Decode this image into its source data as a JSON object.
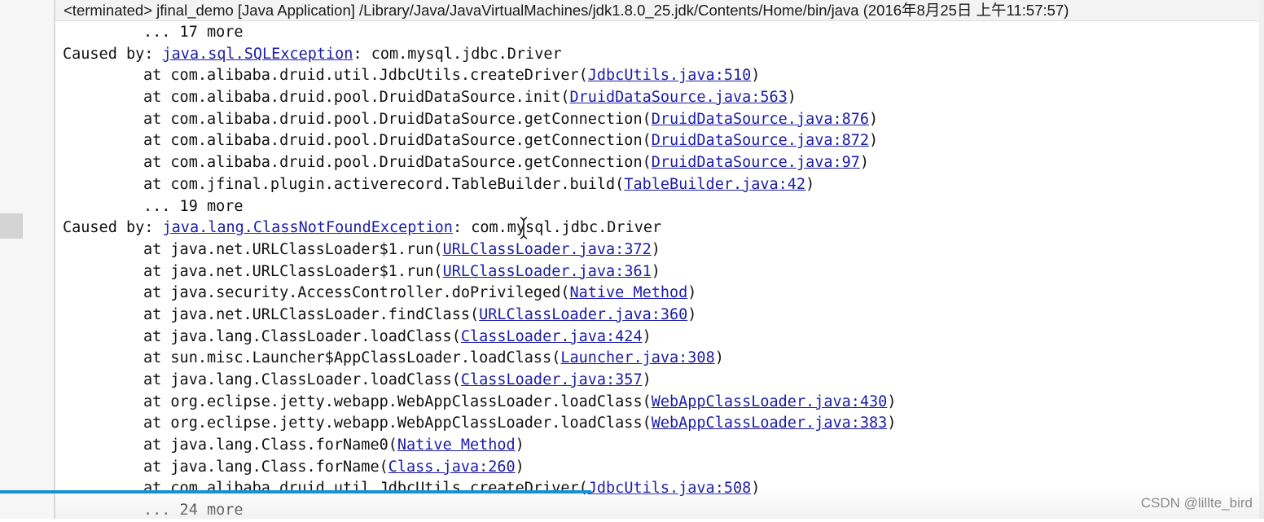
{
  "title_bar": "<terminated> jfinal_demo [Java Application] /Library/Java/JavaVirtualMachines/jdk1.8.0_25.jdk/Contents/Home/bin/java (2016年8月25日 上午11:57:57)",
  "console": {
    "lines": [
      {
        "indent": true,
        "prefix": "... 17 more",
        "link": "",
        "suffix": ""
      },
      {
        "indent": false,
        "prefix": "Caused by: ",
        "link": "java.sql.SQLException",
        "suffix": ": com.mysql.jdbc.Driver"
      },
      {
        "indent": true,
        "prefix": "at com.alibaba.druid.util.JdbcUtils.createDriver(",
        "link": "JdbcUtils.java:510",
        "suffix": ")"
      },
      {
        "indent": true,
        "prefix": "at com.alibaba.druid.pool.DruidDataSource.init(",
        "link": "DruidDataSource.java:563",
        "suffix": ")"
      },
      {
        "indent": true,
        "prefix": "at com.alibaba.druid.pool.DruidDataSource.getConnection(",
        "link": "DruidDataSource.java:876",
        "suffix": ")"
      },
      {
        "indent": true,
        "prefix": "at com.alibaba.druid.pool.DruidDataSource.getConnection(",
        "link": "DruidDataSource.java:872",
        "suffix": ")"
      },
      {
        "indent": true,
        "prefix": "at com.alibaba.druid.pool.DruidDataSource.getConnection(",
        "link": "DruidDataSource.java:97",
        "suffix": ")"
      },
      {
        "indent": true,
        "prefix": "at com.jfinal.plugin.activerecord.TableBuilder.build(",
        "link": "TableBuilder.java:42",
        "suffix": ")"
      },
      {
        "indent": true,
        "prefix": "... 19 more",
        "link": "",
        "suffix": ""
      },
      {
        "indent": false,
        "prefix": "Caused by: ",
        "link": "java.lang.ClassNotFoundException",
        "suffix": ": com.mysql.jdbc.Driver"
      },
      {
        "indent": true,
        "prefix": "at java.net.URLClassLoader$1.run(",
        "link": "URLClassLoader.java:372",
        "suffix": ")"
      },
      {
        "indent": true,
        "prefix": "at java.net.URLClassLoader$1.run(",
        "link": "URLClassLoader.java:361",
        "suffix": ")"
      },
      {
        "indent": true,
        "prefix": "at java.security.AccessController.doPrivileged(",
        "link": "Native Method",
        "suffix": ")"
      },
      {
        "indent": true,
        "prefix": "at java.net.URLClassLoader.findClass(",
        "link": "URLClassLoader.java:360",
        "suffix": ")"
      },
      {
        "indent": true,
        "prefix": "at java.lang.ClassLoader.loadClass(",
        "link": "ClassLoader.java:424",
        "suffix": ")"
      },
      {
        "indent": true,
        "prefix": "at sun.misc.Launcher$AppClassLoader.loadClass(",
        "link": "Launcher.java:308",
        "suffix": ")"
      },
      {
        "indent": true,
        "prefix": "at java.lang.ClassLoader.loadClass(",
        "link": "ClassLoader.java:357",
        "suffix": ")"
      },
      {
        "indent": true,
        "prefix": "at org.eclipse.jetty.webapp.WebAppClassLoader.loadClass(",
        "link": "WebAppClassLoader.java:430",
        "suffix": ")"
      },
      {
        "indent": true,
        "prefix": "at org.eclipse.jetty.webapp.WebAppClassLoader.loadClass(",
        "link": "WebAppClassLoader.java:383",
        "suffix": ")"
      },
      {
        "indent": true,
        "prefix": "at java.lang.Class.forName0(",
        "link": "Native Method",
        "suffix": ")"
      },
      {
        "indent": true,
        "prefix": "at java.lang.Class.forName(",
        "link": "Class.java:260",
        "suffix": ")"
      },
      {
        "indent": true,
        "prefix": "at com.alibaba.druid.util.JdbcUtils.createDriver(",
        "link": "JdbcUtils.java:508",
        "suffix": ")"
      },
      {
        "indent": true,
        "prefix": "... 24 more",
        "link": "",
        "suffix": ""
      }
    ]
  },
  "video_progress": 0.468,
  "watermark": "CSDN @lillte_bird",
  "icons": {
    "cursor": "text-cursor-icon"
  },
  "colors": {
    "link": "#1c1ca8",
    "text": "#111111",
    "progress": "#1a8fd6"
  }
}
